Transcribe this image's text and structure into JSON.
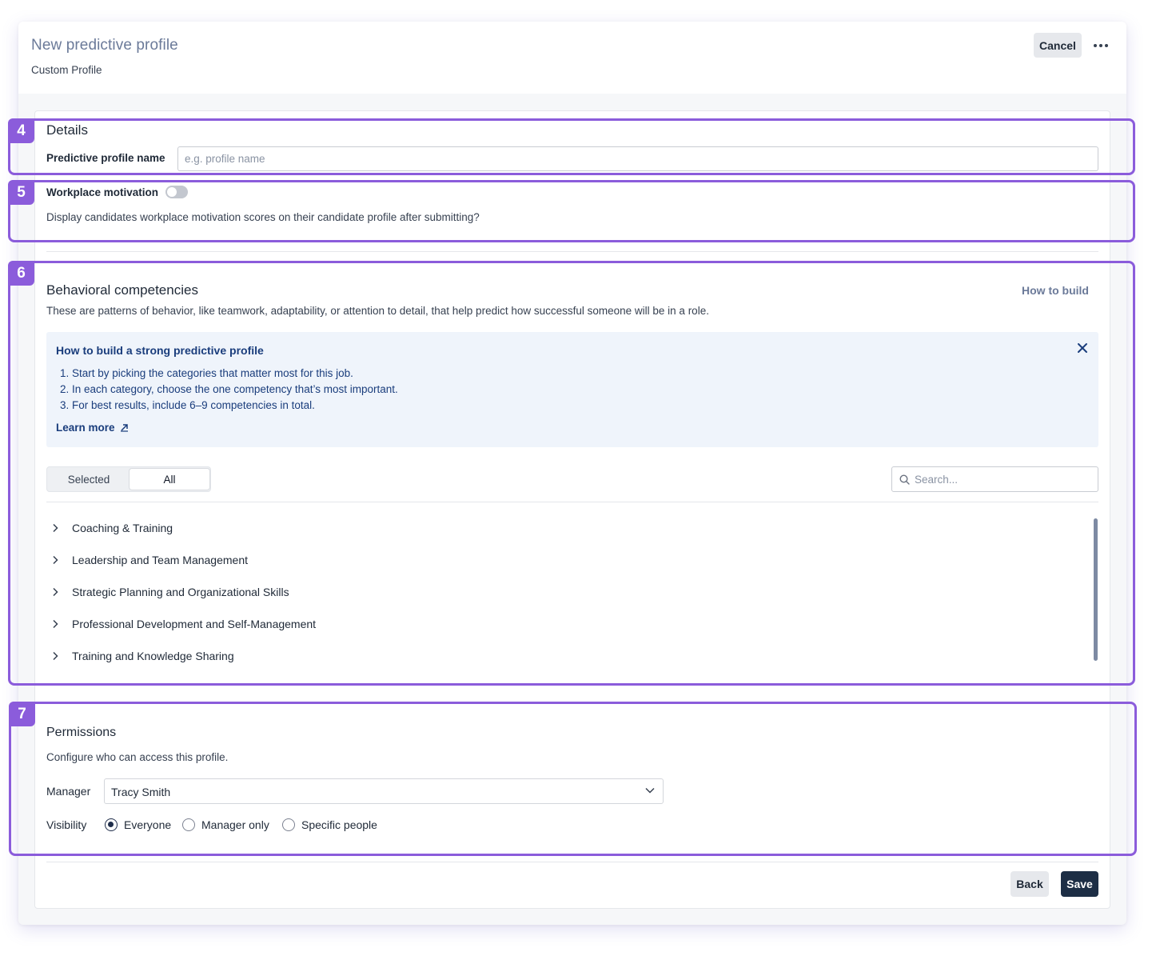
{
  "header": {
    "title": "New predictive profile",
    "subtitle": "Custom Profile",
    "cancel_label": "Cancel",
    "more_icon": "more-horizontal-icon"
  },
  "details": {
    "title": "Details",
    "name_label": "Predictive profile name",
    "name_value": "",
    "name_placeholder": "e.g. profile name"
  },
  "motivation": {
    "label": "Workplace motivation",
    "toggle_on": false,
    "description": "Display candidates workplace motivation scores on their candidate profile after submitting?"
  },
  "competencies": {
    "title": "Behavioral competencies",
    "how_to_build_label": "How to build",
    "description": "These are patterns of behavior, like teamwork, adaptability, or attention to detail, that help predict how successful someone will be in a role.",
    "info": {
      "title": "How to build a strong predictive profile",
      "steps": [
        "1. Start by picking the categories that matter most for this job.",
        "2. In each category, choose the one competency that’s most important.",
        "3. For best results, include 6–9 competencies in total."
      ],
      "learn_more_label": "Learn more",
      "close_icon": "close-icon"
    },
    "filter_tabs": [
      {
        "label": "Selected",
        "active": false
      },
      {
        "label": "All",
        "active": true
      }
    ],
    "search": {
      "value": "",
      "placeholder": "Search..."
    },
    "categories": [
      "Coaching & Training",
      "Leadership and Team Management",
      "Strategic Planning and Organizational Skills",
      "Professional Development and Self-Management",
      "Training and Knowledge Sharing"
    ]
  },
  "permissions": {
    "title": "Permissions",
    "description": "Configure who can access this profile.",
    "manager_label": "Manager",
    "manager_value": "Tracy Smith",
    "visibility_label": "Visibility",
    "visibility_options": [
      {
        "label": "Everyone",
        "selected": true
      },
      {
        "label": "Manager only",
        "selected": false
      },
      {
        "label": "Specific people",
        "selected": false
      }
    ]
  },
  "footer": {
    "back_label": "Back",
    "save_label": "Save"
  },
  "annotations": [
    "4",
    "5",
    "6",
    "7"
  ],
  "colors": {
    "annotation": "#8b5cdb",
    "primary_button": "#1d2e45",
    "info_text": "#1a3d7c",
    "info_bg": "#eff4fb",
    "title_muted": "#6b7a99"
  }
}
